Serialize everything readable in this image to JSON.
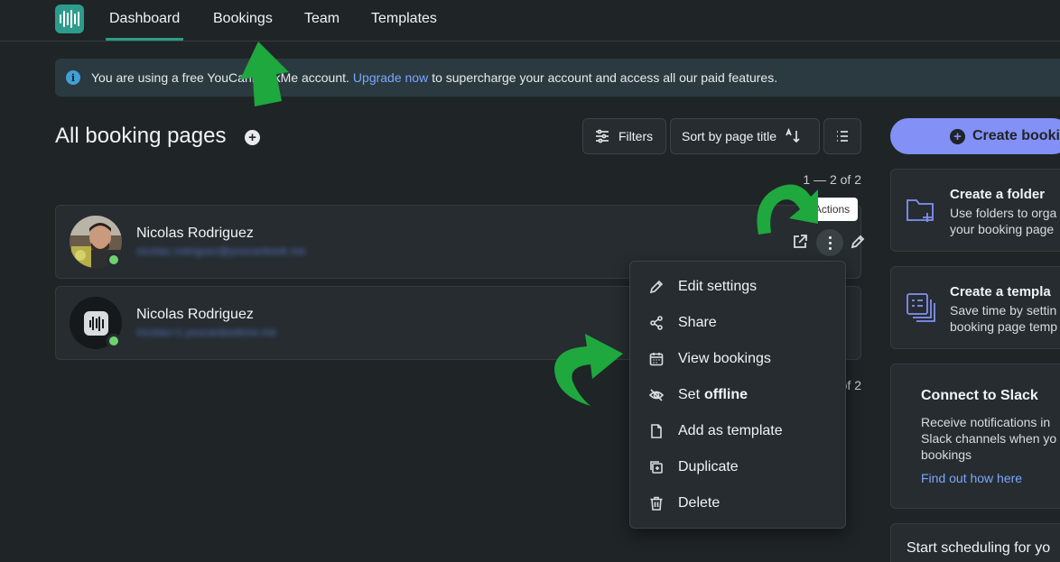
{
  "nav": {
    "tabs": [
      "Dashboard",
      "Bookings",
      "Team",
      "Templates"
    ],
    "active_tab": "Dashboard",
    "logo_icon": "youcanbookme-logo-icon"
  },
  "banner": {
    "text_before": "You are using a free YouCanBookMe account.",
    "link": "Upgrade now",
    "text_after": "to supercharge your account and access all our paid features."
  },
  "main": {
    "title": "All booking pages",
    "filters_label": "Filters",
    "sort_label": "Sort by page title",
    "pagination_top": "1 — 2 of 2",
    "pagination_bottom": "of 2",
    "cards": [
      {
        "name": "Nicolas Rodriguez",
        "email": "nicolas.rodriguez@youcanbook.me",
        "online": true
      },
      {
        "name": "Nicolas Rodriguez",
        "email": "nicolas+1.youcanbookme.me",
        "online": true
      }
    ],
    "tooltip": "Actions"
  },
  "actions_menu": {
    "items": [
      {
        "label": "Edit settings",
        "icon": "pencil-icon"
      },
      {
        "label": "Share",
        "icon": "share-icon"
      },
      {
        "label": "View bookings",
        "icon": "calendar-icon"
      },
      {
        "label": "Set",
        "bold": "offline",
        "icon": "eye-off-icon"
      },
      {
        "label": "Add as template",
        "icon": "file-icon"
      },
      {
        "label": "Duplicate",
        "icon": "duplicate-icon"
      },
      {
        "label": "Delete",
        "icon": "trash-icon"
      }
    ]
  },
  "sidebar": {
    "create_button": "Create booki",
    "folder": {
      "title": "Create a folder",
      "desc_1": "Use folders to orga",
      "desc_2": "your booking page"
    },
    "template": {
      "title": "Create a templa",
      "desc_1": "Save time by settin",
      "desc_2": "booking page temp"
    },
    "slack": {
      "title": "Connect to Slack",
      "desc": "Receive notifications in Slack channels when yo bookings",
      "link": "Find out how here"
    },
    "start": {
      "title": "Start scheduling for yo"
    }
  },
  "colors": {
    "background": "#1f2427",
    "accent": "#2d9c8c",
    "primary_button": "#8390f5",
    "link": "#7aa7ff",
    "annotation_arrow": "#1fa83d",
    "online": "#6fd26f"
  }
}
